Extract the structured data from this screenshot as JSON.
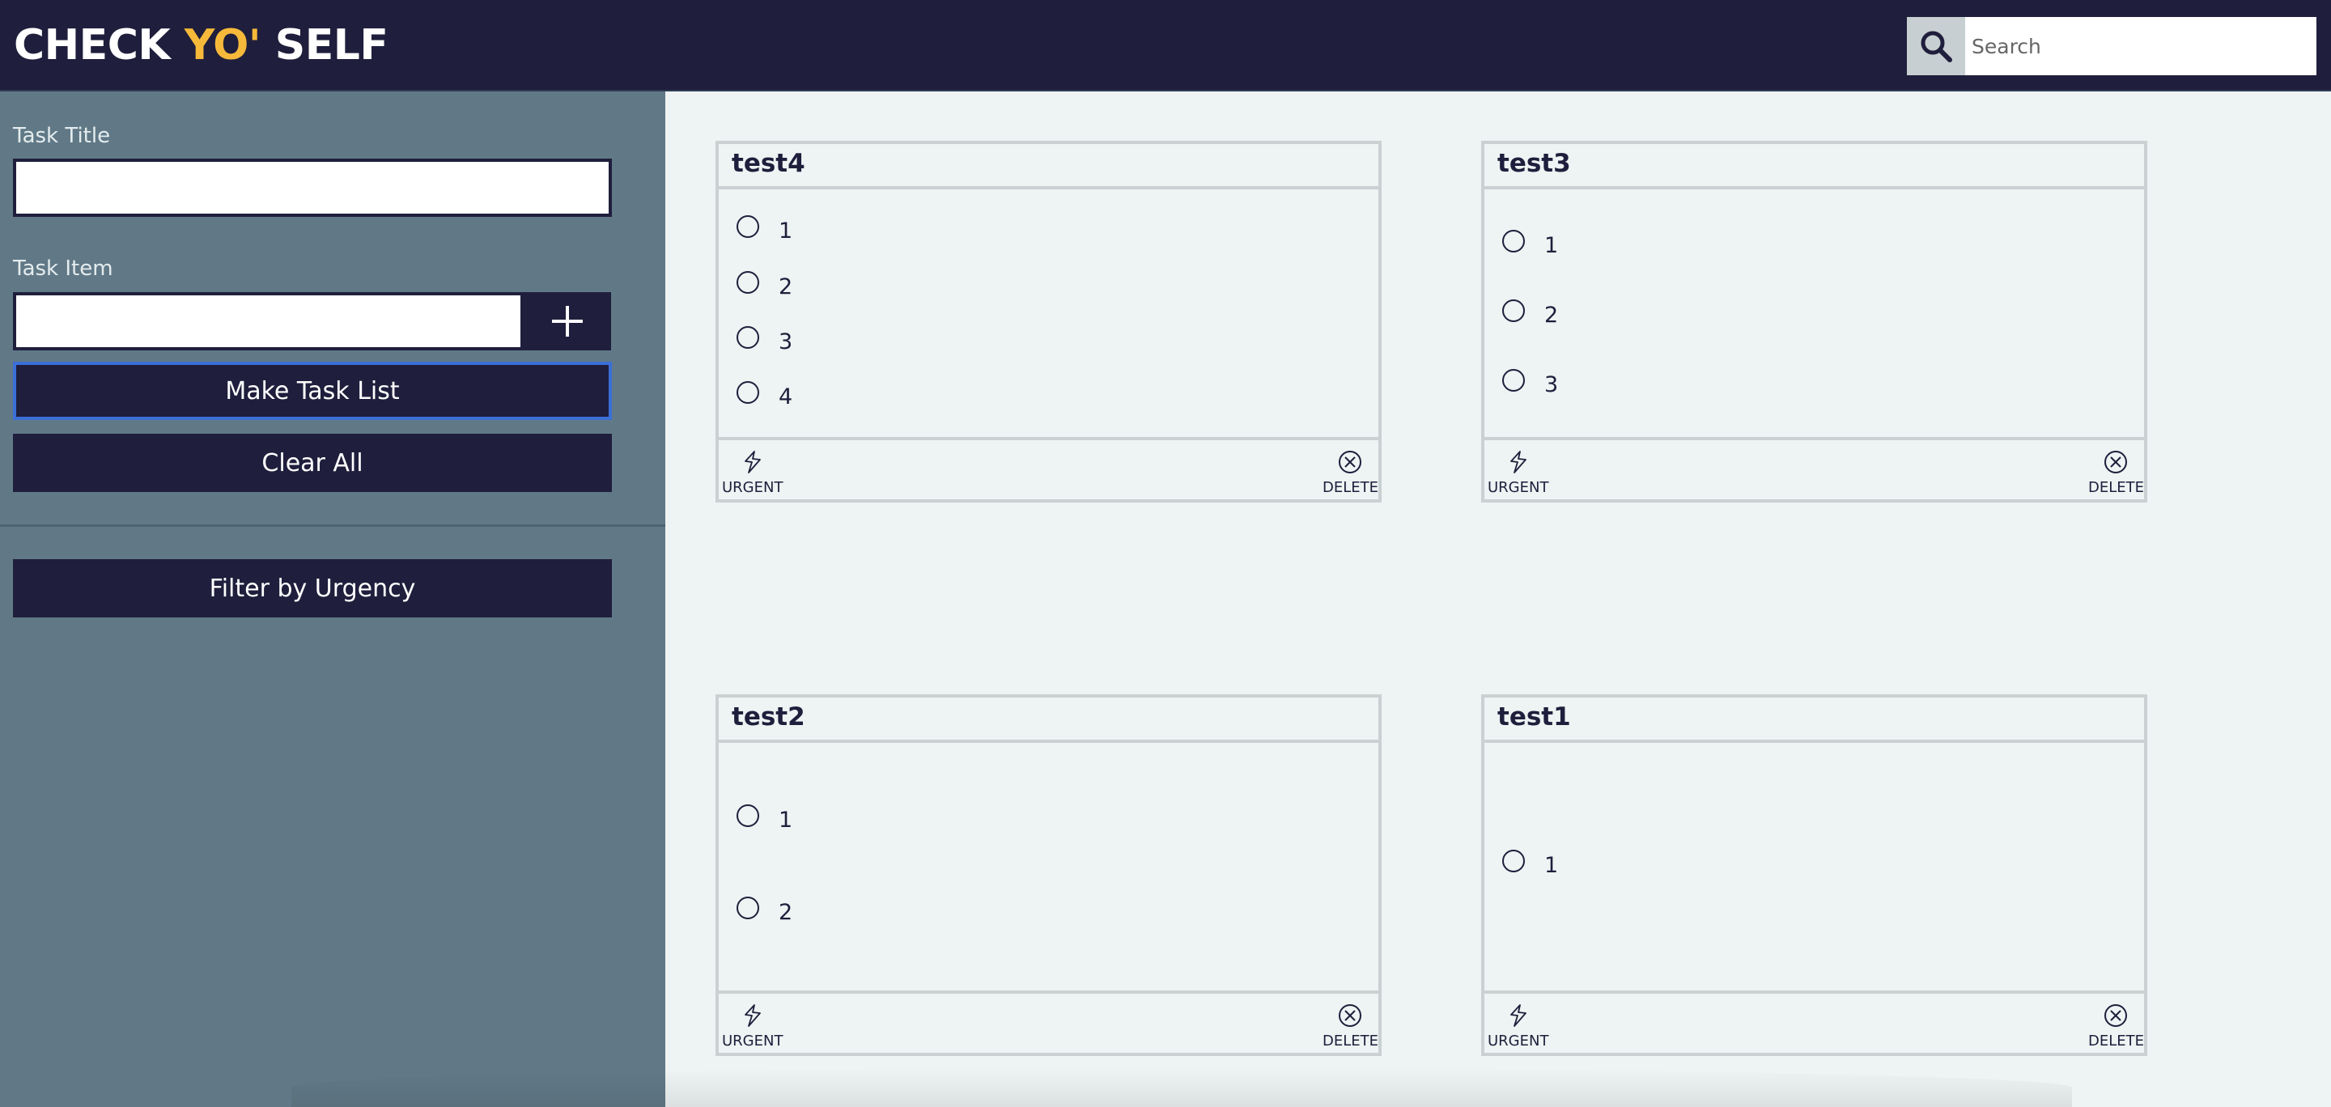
{
  "header": {
    "logo_part1": "CHECK ",
    "logo_accent": "YO'",
    "logo_part2": " SELF",
    "search_placeholder": "Search",
    "search_icon": "search-icon"
  },
  "sidebar": {
    "task_title_label": "Task Title",
    "task_title_value": "",
    "task_item_label": "Task Item",
    "task_item_value": "",
    "add_icon": "plus-icon",
    "make_task_list_label": "Make Task List",
    "clear_all_label": "Clear All",
    "filter_label": "Filter by Urgency"
  },
  "colors": {
    "navy": "#1f1e3c",
    "accent_yellow": "#f6b93a",
    "sidebar_bg": "#617987",
    "content_bg": "#eef3f3",
    "card_border": "#c9d1d3",
    "focus_outline": "#3b6fd8"
  },
  "cards": [
    {
      "title": "test4",
      "items": [
        "1",
        "2",
        "3",
        "4"
      ],
      "urgent_label": "URGENT",
      "delete_label": "DELETE"
    },
    {
      "title": "test3",
      "items": [
        "1",
        "2",
        "3"
      ],
      "urgent_label": "URGENT",
      "delete_label": "DELETE"
    },
    {
      "title": "test2",
      "items": [
        "1",
        "2"
      ],
      "urgent_label": "URGENT",
      "delete_label": "DELETE"
    },
    {
      "title": "test1",
      "items": [
        "1"
      ],
      "urgent_label": "URGENT",
      "delete_label": "DELETE"
    }
  ]
}
